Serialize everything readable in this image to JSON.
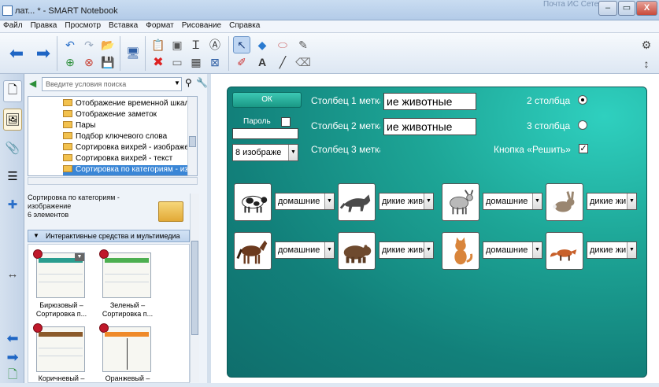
{
  "window": {
    "title": "лат... * - SMART Notebook",
    "ghost_tab": "Почта ИС Сетевого",
    "minimize": "–",
    "maximize": "▭",
    "close": "X"
  },
  "menu": {
    "items": [
      "Файл",
      "Правка",
      "Просмотр",
      "Вставка",
      "Формат",
      "Рисование",
      "Справка"
    ]
  },
  "toolbar": {
    "icons": [
      "arrow-left-icon",
      "arrow-right-icon",
      "undo-icon",
      "redo-icon",
      "open-icon",
      "new-page-icon",
      "delete-page-icon",
      "save-icon",
      "screen-icon",
      "paste-icon",
      "delete-icon",
      "screen-shade-icon",
      "table-icon",
      "text-icon",
      "pointer-icon",
      "fill-icon",
      "eraser-icon",
      "magic-pen-icon",
      "pens-icon",
      "text-color-icon",
      "line-icon",
      "shape-eraser-icon",
      "gear-icon",
      "move-toolbar-icon"
    ]
  },
  "gallery": {
    "search_placeholder": "Введите условия поиска",
    "tree_items": [
      "Отображение временной шкалы",
      "Отображение заметок",
      "Пары",
      "Подбор ключевого слова",
      "Сортировка вихрей - изображение",
      "Сортировка вихрей - текст",
      "Сортировка по категориям - изображение"
    ],
    "selected_index": 6,
    "info_title": "Сортировка по категориям - изображение",
    "info_count": "6 элементов",
    "category": "Интерактивные средства и мультимедиа",
    "thumbs": [
      {
        "label1": "Бирюзовый –",
        "label2": "Сортировка п...",
        "color": "#2a9d8f"
      },
      {
        "label1": "Зеленый –",
        "label2": "Сортировка п...",
        "color": "#4caf50"
      },
      {
        "label1": "Коричневый –",
        "label2": "",
        "color": "#8b5a2b"
      },
      {
        "label1": "Оранжевый –",
        "label2": "",
        "color": "#ef8a2a"
      }
    ]
  },
  "board": {
    "ok_label": "ОК",
    "password_label": "Пароль",
    "col1_label": "Столбец 1 метка",
    "col1_value": "ие животные",
    "col2_label": "Столбец 2 метка",
    "col2_value": "ие животные",
    "col3_label": "Столбец 3 метка",
    "images_select": "8 изображе",
    "two_cols": "2 столбца",
    "three_cols": "3 столбца",
    "solve_button_label": "Кнопка «Решить»",
    "columns_selected": 2,
    "solve_checked": true,
    "row1": [
      {
        "animal": "cow",
        "choice": "домашние"
      },
      {
        "animal": "wolf",
        "choice": "дикие живо"
      },
      {
        "animal": "goat",
        "choice": "домашние"
      },
      {
        "animal": "rabbit",
        "choice": "дикие живо"
      }
    ],
    "row2": [
      {
        "animal": "horse",
        "choice": "домашние"
      },
      {
        "animal": "bear",
        "choice": "дикие живо"
      },
      {
        "animal": "cat",
        "choice": "домашние"
      },
      {
        "animal": "fox",
        "choice": "дикие живо"
      }
    ]
  }
}
